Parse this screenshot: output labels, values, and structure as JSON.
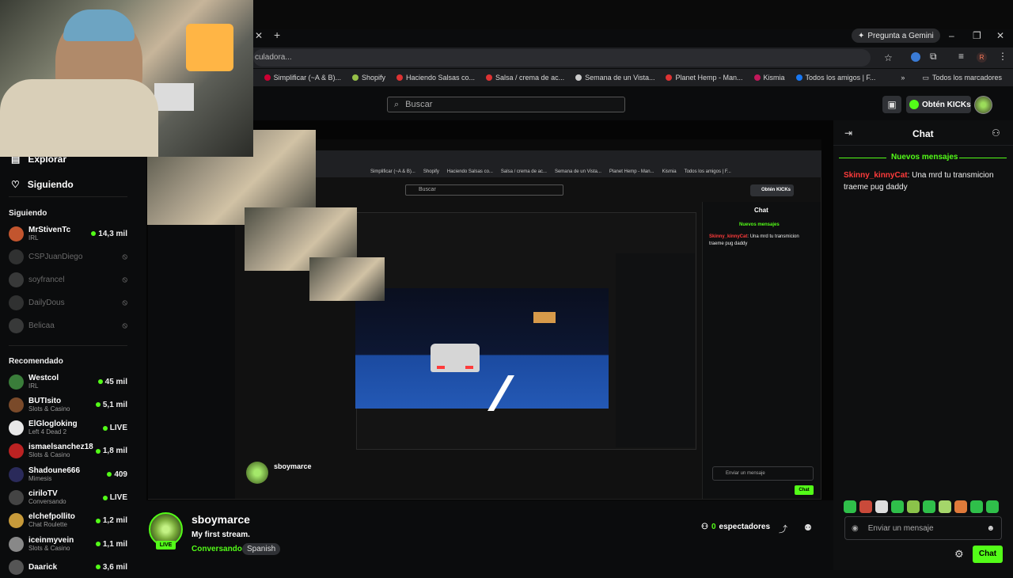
{
  "browser": {
    "gemini_label": "Pregunta a Gemini",
    "omnibox_text": "culadora...",
    "bookmarks": [
      {
        "label": "Simplificar (~A & B)..."
      },
      {
        "label": "Shopify"
      },
      {
        "label": "Haciendo Salsas co..."
      },
      {
        "label": "Salsa / crema de ac..."
      },
      {
        "label": "Semana de un Vista..."
      },
      {
        "label": "Planet Hemp - Man..."
      },
      {
        "label": "Kismia"
      },
      {
        "label": "Todos los amigos | F..."
      }
    ],
    "all_bookmarks_label": "Todos los marcadores",
    "profile_initial": "R"
  },
  "header": {
    "search_placeholder": "Buscar",
    "kicks_label": "Obtén KICKs"
  },
  "sidebar": {
    "nav": [
      {
        "label": "Explorar"
      },
      {
        "label": "Siguiendo"
      }
    ],
    "following_title": "Siguiendo",
    "following": [
      {
        "name": "MrStivenTc",
        "category": "IRL",
        "viewers": "14,3 mil",
        "live": true,
        "color": "#c2552e"
      },
      {
        "name": "CSPJuanDiego",
        "live": false,
        "color": "#555"
      },
      {
        "name": "soyfrancel",
        "live": false,
        "color": "#666"
      },
      {
        "name": "DailyDous",
        "live": false,
        "color": "#555"
      },
      {
        "name": "Belicaa",
        "live": false,
        "color": "#666"
      }
    ],
    "recommended_title": "Recomendado",
    "recommended": [
      {
        "name": "Westcol",
        "category": "IRL",
        "viewers": "45 mil",
        "color": "#3a7d3a"
      },
      {
        "name": "BUTIsito",
        "category": "Slots & Casino",
        "viewers": "5,1 mil",
        "color": "#7a4a2a"
      },
      {
        "name": "ElGlogloking",
        "category": "Left 4 Dead 2",
        "viewers": "LIVE",
        "color": "#e8e8e8"
      },
      {
        "name": "ismaelsanchez18",
        "category": "Slots & Casino",
        "viewers": "1,8 mil",
        "color": "#b22"
      },
      {
        "name": "Shadoune666",
        "category": "Mimesis",
        "viewers": "409",
        "color": "#2a2a5a"
      },
      {
        "name": "ciriloTV",
        "category": "Conversando",
        "viewers": "LIVE",
        "color": "#444"
      },
      {
        "name": "elchefpollito",
        "category": "Chat Roulette",
        "viewers": "1,2 mil",
        "color": "#c79a3a"
      },
      {
        "name": "iceinmyvein",
        "category": "Slots & Casino",
        "viewers": "1,1 mil",
        "color": "#888"
      },
      {
        "name": "Daarick",
        "category": "",
        "viewers": "3,6 mil",
        "color": "#555"
      }
    ]
  },
  "nested": {
    "search_placeholder": "Buscar",
    "kicks_label": "Obtén KICKs",
    "streamer": "sboymarce",
    "chat_title": "Chat"
  },
  "stream": {
    "streamer": "sboymarce",
    "live_badge": "LIVE",
    "title": "My first stream.",
    "category": "Conversando",
    "language": "Spanish",
    "viewers_count": "0",
    "viewers_label": "espectadores"
  },
  "chat": {
    "title": "Chat",
    "new_messages": "Nuevos mensajes",
    "messages": [
      {
        "user": "Skinny_kinnyCat",
        "text": ": Una mrd tu transmicion traeme pug daddy"
      }
    ],
    "input_placeholder": "Enviar un mensaje",
    "send_label": "Chat"
  },
  "colors": {
    "accent": "#53fc18",
    "chat_user": "#ff3b3b",
    "background": "#0b0c0d"
  }
}
